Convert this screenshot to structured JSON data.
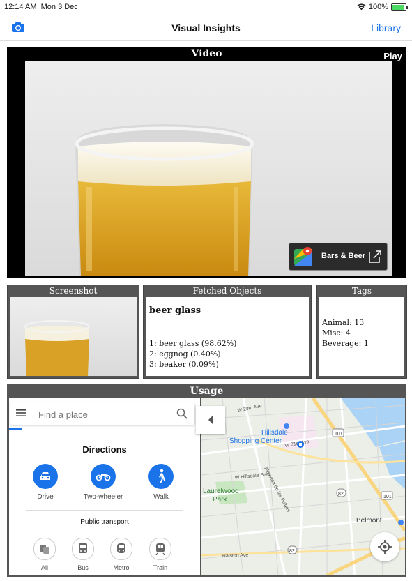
{
  "status_bar": {
    "time": "12:14 AM",
    "date": "Mon 3 Dec",
    "battery": "100%"
  },
  "nav": {
    "title": "Visual Insights",
    "library_label": "Library",
    "camera_icon": "camera-icon"
  },
  "video": {
    "title": "Video",
    "play_label": "Play",
    "maps_badge_label": "Bars & Beer"
  },
  "screenshot": {
    "title": "Screenshot"
  },
  "fetched_objects": {
    "title": "Fetched Objects",
    "top_label": "beer glass",
    "results": [
      "1: beer glass (98.62%)",
      "2: eggnog (0.40%)",
      "3: beaker (0.09%)"
    ]
  },
  "tags": {
    "title": "Tags",
    "items": [
      "Animal: 13",
      "Misc: 4",
      "Beverage: 1"
    ]
  },
  "usage": {
    "title": "Usage",
    "search_placeholder": "Find a place",
    "directions_title": "Directions",
    "modes": [
      "Drive",
      "Two-wheeler",
      "Walk"
    ],
    "public_transport_title": "Public transport",
    "transit_modes": [
      "All",
      "Bus",
      "Metro",
      "Train"
    ]
  },
  "map": {
    "labels": {
      "hillsdale": "Hillsdale",
      "shopping_center": "Shopping Center",
      "laurelwood": "Laurelwood",
      "park": "Park",
      "belmont": "Belmont",
      "w20th": "W 20th Ave",
      "w31st": "W 31st Ave",
      "hillsdale_blvd": "W Hillsdale Blvd",
      "alameda": "Alameda de las Pulgas",
      "ralston": "Ralston Ave",
      "route101a": "101",
      "route101b": "101",
      "route82a": "82",
      "route82b": "82"
    }
  },
  "colors": {
    "accent": "#1a73e8",
    "panel_header": "#555555"
  }
}
